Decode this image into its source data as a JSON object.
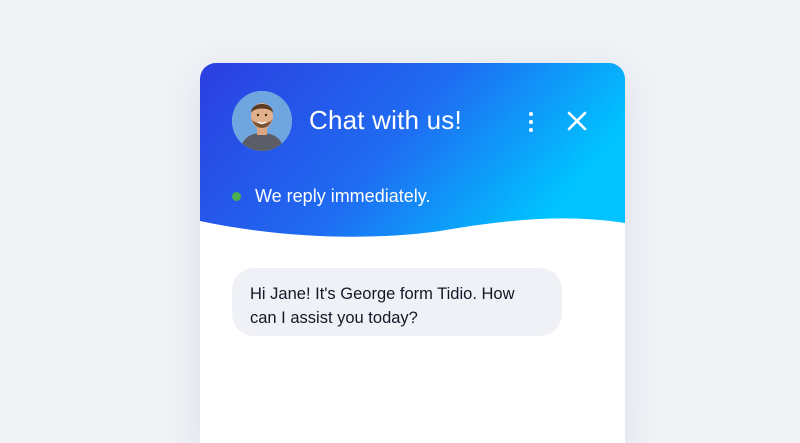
{
  "header": {
    "title": "Chat with us!",
    "status_text": "We reply immediately.",
    "status_color": "#4caf50",
    "gradient_start": "#2c3ee0",
    "gradient_end": "#00c3ff",
    "menu_icon": "more-vertical-icon",
    "close_icon": "close-icon"
  },
  "messages": [
    {
      "text": "Hi Jane! It's George form Tidio. How can I assist you today?"
    }
  ]
}
